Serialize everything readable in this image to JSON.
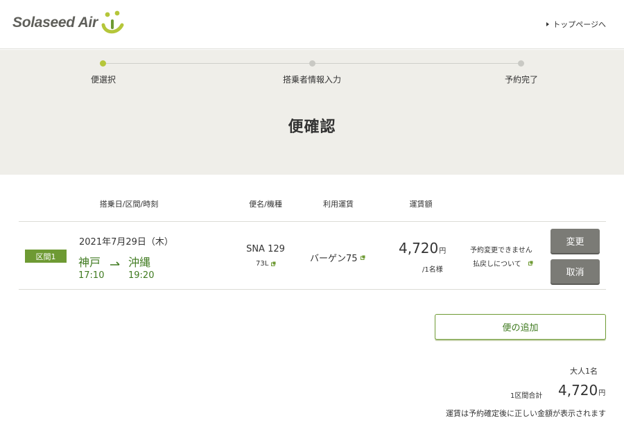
{
  "header": {
    "logo_text": "Solaseed Air",
    "top_link": "トップページへ"
  },
  "progress": {
    "steps": [
      "便選択",
      "搭乗者情報入力",
      "予約完了"
    ],
    "active_index": 0,
    "page_title": "便確認"
  },
  "table": {
    "headers": {
      "date_route_time": "搭乗日/区間/時刻",
      "flight_aircraft": "便名/機種",
      "fare_type": "利用運賃",
      "fare_amount": "運賃額"
    },
    "rows": [
      {
        "segment": "区間1",
        "date": "2021年7月29日（木）",
        "from_city": "神戸",
        "to_city": "沖縄",
        "dep_time": "17:10",
        "arr_time": "19:20",
        "flight": "SNA 129",
        "aircraft": "73L",
        "fare_type": "バーゲン75",
        "price": "4,720",
        "price_unit": "円",
        "per": "/1名様",
        "note_change": "予約変更できません",
        "note_refund": "払戻しについて",
        "change_label": "変更",
        "cancel_label": "取消"
      }
    ]
  },
  "add_flight_label": "便の追加",
  "summary": {
    "passengers": "大人1名",
    "total_label": "1区間合計",
    "total_price": "4,720",
    "total_unit": "円",
    "disclaimer": "運賃は予約確定後に正しい金額が表示されます"
  },
  "colors": {
    "brand_green": "#6e9a33",
    "route_green": "#3f7a1f",
    "active_dot": "#b5c63a",
    "band_bg": "#efeee9",
    "button_gray": "#7b7b76"
  }
}
